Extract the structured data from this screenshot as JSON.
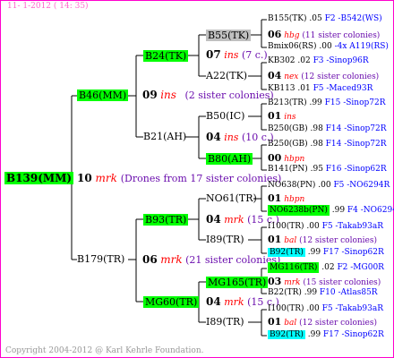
{
  "header": {
    "date": "11-  1-2012 ( 14: 35)"
  },
  "footer": {
    "copyright": "Copyright 2004-2012 @ Karl Kehrle Foundation."
  },
  "root": {
    "id": "B139(MM)"
  },
  "gen1": {
    "b46": {
      "id": "B46(MM)",
      "sib_num": "09",
      "sib_code": "ins",
      "sib_text": "(2 sister colonies)"
    },
    "b179": {
      "id": "B179(TR)",
      "sib_num": "06",
      "sib_code": "mrk",
      "sib_text": "(21 sister colonies)"
    },
    "root_sib": {
      "num": "10",
      "code": "mrk",
      "text": "(Drones from 17 sister colonies)"
    }
  },
  "gen2": {
    "b24": {
      "id": "B24(TK)",
      "sib_num": "07",
      "sib_code": "ins",
      "sib_text": "(7 c.)"
    },
    "b21": {
      "id": "B21(AH)",
      "sib_num": "04",
      "sib_code": "ins",
      "sib_text": "(10 c.)"
    },
    "b93": {
      "id": "B93(TR)",
      "sib_num": "04",
      "sib_code": "mrk",
      "sib_text": "(15 c.)"
    },
    "mg60": {
      "id": "MG60(TR)",
      "sib_num": "04",
      "sib_code": "mrk",
      "sib_text": "(15 c.)"
    }
  },
  "gen3": {
    "b55": {
      "id": "B55(TK)",
      "sib_num": "06",
      "sib_code": "hbg",
      "sib_text": "(11 sister colonies)"
    },
    "a22": {
      "id": "A22(TK)",
      "sib_num": "04",
      "sib_code": "nex",
      "sib_text": "(12 sister colonies)"
    },
    "b50": {
      "id": "B50(IC)",
      "sib_num": "01",
      "sib_code": "ins",
      "sib_text": ""
    },
    "b80": {
      "id": "B80(AH)",
      "sib_num": "00",
      "sib_code": "hbpn",
      "sib_text": ""
    },
    "no61": {
      "id": "NO61(TR)",
      "sib_num": "01",
      "sib_code": "hbpn",
      "sib_text": ""
    },
    "i89a": {
      "id": "I89(TR)",
      "sib_num": "01",
      "sib_code": "bal",
      "sib_text": "(12 sister colonies)"
    },
    "mg165": {
      "id": "MG165(TR)",
      "sib_num": "03",
      "sib_code": "mrk",
      "sib_text": "(15 sister colonies)"
    },
    "i89b": {
      "id": "I89(TR)",
      "sib_num": "01",
      "sib_code": "bal",
      "sib_text": "(12 sister colonies)"
    }
  },
  "gen4": [
    {
      "id": "B155(TK)",
      "val": ".05",
      "code": "F2 -B542(WS)"
    },
    {
      "id": "Bmix06(RS)",
      "val": ".00",
      "code": "-4x A119(RS)"
    },
    {
      "id": "KB302",
      "val": ".02",
      "code": "F3 -Sinop96R"
    },
    {
      "id": "KB113",
      "val": ".01",
      "code": "F5 -Maced93R"
    },
    {
      "id": "B213(TR)",
      "val": ".99",
      "code": "F15 -Sinop72R"
    },
    {
      "id": "B250(GB)",
      "val": ".98",
      "code": "F14 -Sinop72R"
    },
    {
      "id": "B250(GB)",
      "val": ".98",
      "code": "F14 -Sinop72R"
    },
    {
      "id": "B141(PN)",
      "val": ".95",
      "code": "F16 -Sinop62R"
    },
    {
      "id": "NO638(PN)",
      "val": ".00",
      "code": "F5 -NO6294R"
    },
    {
      "id": "NO6238b(PN)",
      "val": ".99",
      "code": "F4 -NO6294R"
    },
    {
      "id": "I100(TR)",
      "val": ".00",
      "code": "F5 -Takab93aR"
    },
    {
      "id": "B92(TR)",
      "val": ".99",
      "code": "F17 -Sinop62R"
    },
    {
      "id": "MG116(TR)",
      "val": ".02",
      "code": "F2 -MG00R"
    },
    {
      "id": "B22(TR)",
      "val": ".99",
      "code": "F10 -Atlas85R"
    },
    {
      "id": "I100(TR)",
      "val": ".00",
      "code": "F5 -Takab93aR"
    },
    {
      "id": "B92(TR)",
      "val": ".99",
      "code": "F17 -Sinop62R"
    }
  ]
}
